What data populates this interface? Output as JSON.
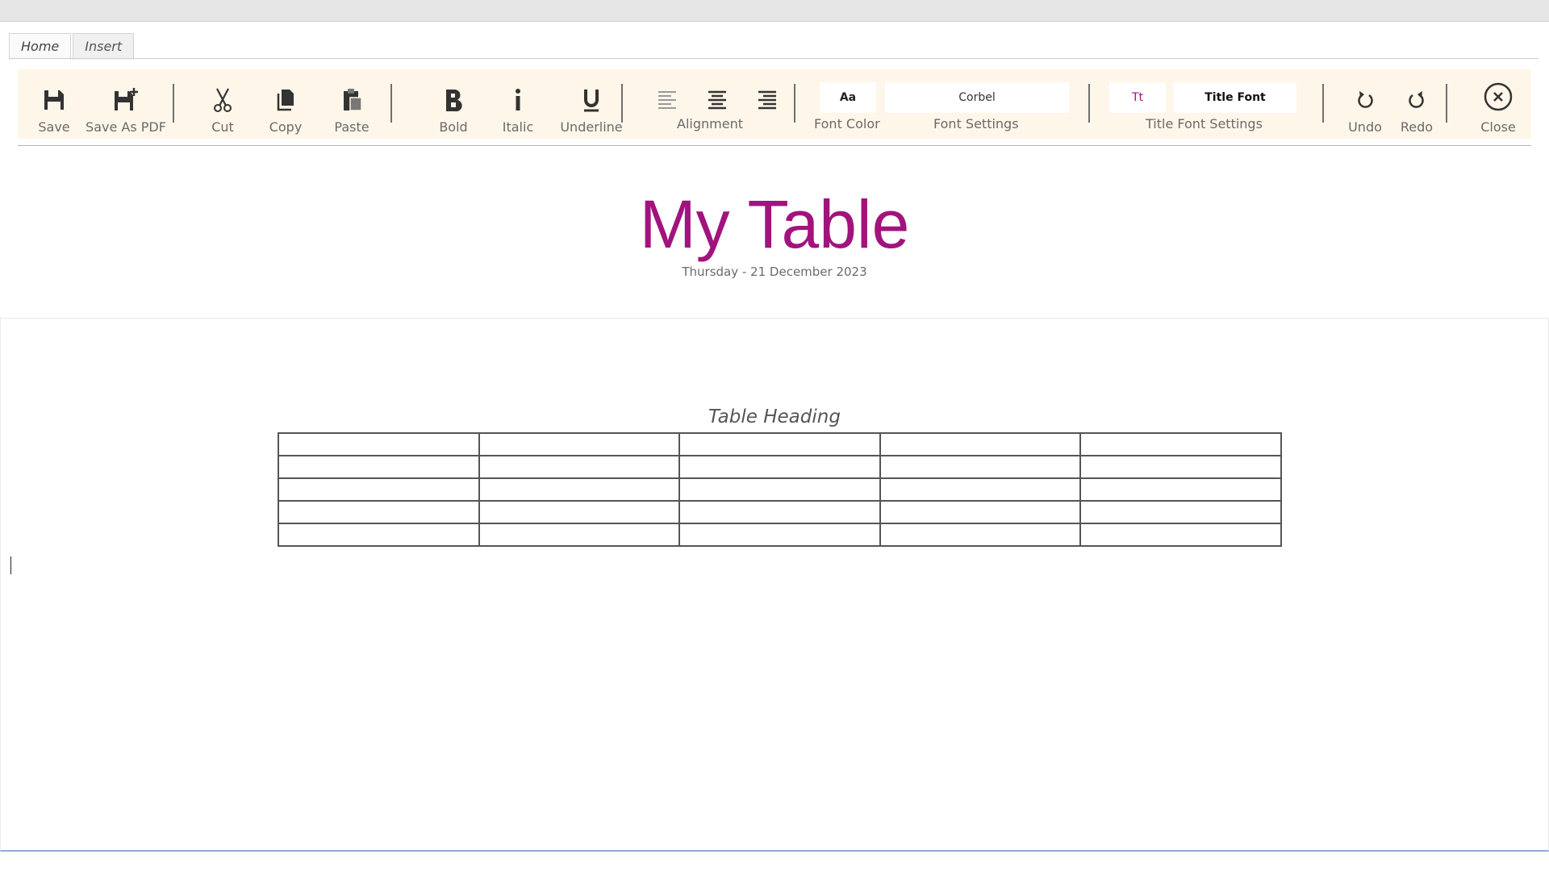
{
  "tabs": [
    {
      "label": "Home",
      "active": true
    },
    {
      "label": "Insert",
      "active": false
    }
  ],
  "toolbar": {
    "save": "Save",
    "save_pdf": "Save As PDF",
    "cut": "Cut",
    "copy": "Copy",
    "paste": "Paste",
    "bold": "Bold",
    "italic": "Italic",
    "underline": "Underline",
    "alignment": "Alignment",
    "font_color_sample": "Aa",
    "font_color": "Font Color",
    "font_name": "Corbel",
    "font_settings": "Font Settings",
    "title_font_sample": "Tt",
    "title_font_name": "Title Font",
    "title_font_settings": "Title Font Settings",
    "undo": "Undo",
    "redo": "Redo",
    "close": "Close"
  },
  "colors": {
    "title": "#a2137d",
    "ribbon_bg": "#fff6ea",
    "title_font_sample": "#a2137d"
  },
  "document": {
    "title": "My Table",
    "date": "Thursday - 21 December 2023",
    "table_heading": "Table Heading",
    "table": {
      "rows": 5,
      "columns": 5
    }
  },
  "icons": [
    "save-icon",
    "save-as-pdf-icon",
    "scissors-icon",
    "copy-icon",
    "paste-icon",
    "bold-icon",
    "italic-icon",
    "underline-icon",
    "align-left-icon",
    "align-center-icon",
    "align-right-icon",
    "undo-icon",
    "redo-icon",
    "close-icon"
  ]
}
